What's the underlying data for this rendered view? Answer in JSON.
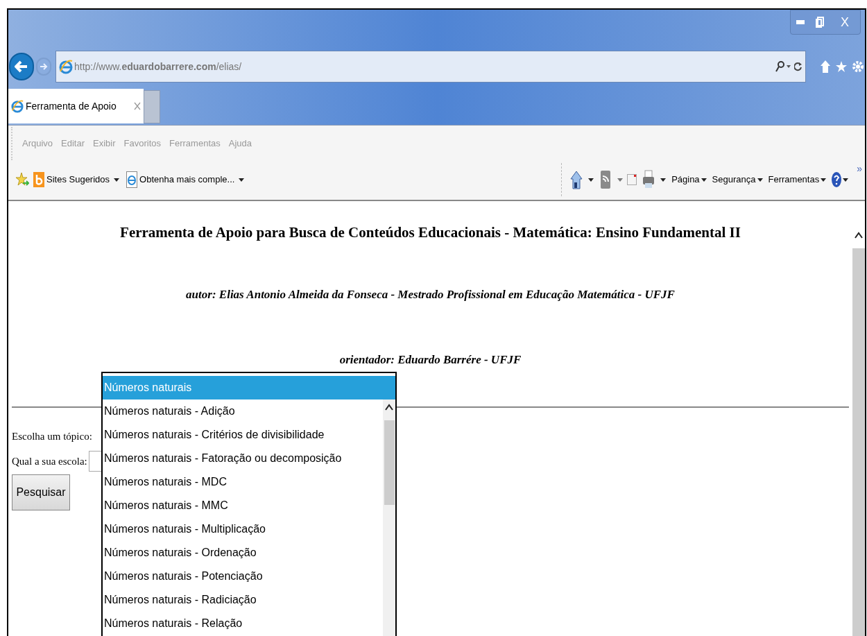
{
  "window": {
    "close_label": "X"
  },
  "address_bar": {
    "url": "http://www.**eduardobarrere.com**/elias/"
  },
  "tabs": [
    {
      "label": "Ferramenta de Apoio",
      "selected": true
    }
  ],
  "menu_bar": [
    "Arquivo",
    "Editar",
    "Exibir",
    "Favoritos",
    "Ferramentas",
    "Ajuda"
  ],
  "favorites_bar": [
    {
      "label": "Sites Sugeridos"
    },
    {
      "label": "Obtenha mais comple..."
    }
  ],
  "command_bar": [
    "Página",
    "Segurança",
    "Ferramentas"
  ],
  "command_overflow": "»",
  "page": {
    "heading": "Ferramenta de Apoio para Busca de Conteúdos Educacionais - Matemática: Ensino Fundamental II",
    "author": "autor: Elias Antonio Almeida da Fonseca - Mestrado Profissional em Educação Matemática - UFJF",
    "advisor": "orientador: Eduardo Barrére - UFJF",
    "topic_label": "Escolha um tópico:",
    "school_label": "Qual a sua escola:",
    "search_button": "Pesquisar"
  },
  "topic_options": [
    {
      "label": "Números naturais",
      "selected": true
    },
    {
      "label": "Números naturais - Adição",
      "selected": false
    },
    {
      "label": "Números naturais - Critérios de divisibilidade",
      "selected": false
    },
    {
      "label": "Números naturais - Fatoração ou decomposição",
      "selected": false
    },
    {
      "label": "Números naturais - MDC",
      "selected": false
    },
    {
      "label": "Números naturais - MMC",
      "selected": false
    },
    {
      "label": "Números naturais - Multiplicação",
      "selected": false
    },
    {
      "label": "Números naturais - Ordenação",
      "selected": false
    },
    {
      "label": "Números naturais - Potenciação",
      "selected": false
    },
    {
      "label": "Números naturais - Radiciação",
      "selected": false
    },
    {
      "label": "Números naturais - Relação",
      "selected": false
    }
  ]
}
